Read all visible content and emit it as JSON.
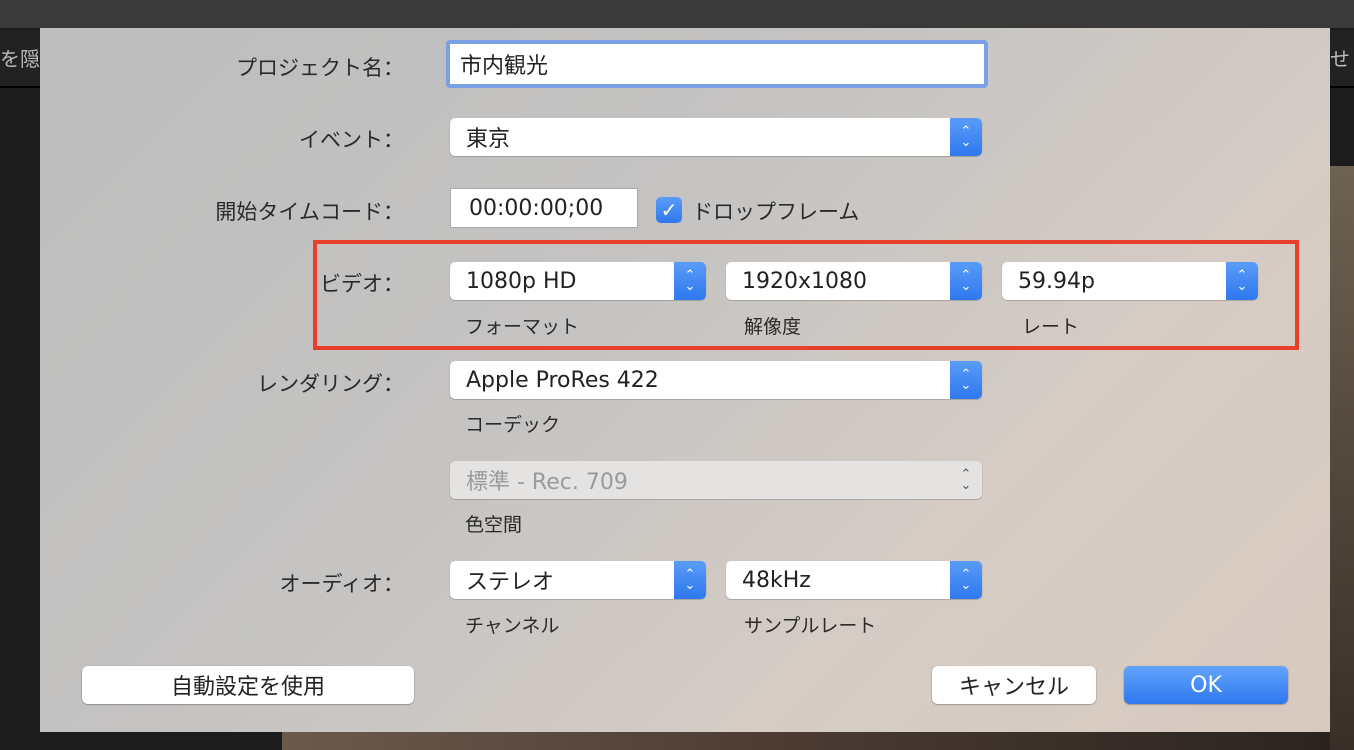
{
  "background": {
    "left_fragment": "を隠す",
    "right_fragment": "せ"
  },
  "project_name": {
    "label": "プロジェクト名：",
    "value": "市内観光"
  },
  "event": {
    "label": "イベント：",
    "value": "東京"
  },
  "timecode": {
    "label": "開始タイムコード：",
    "value": "00:00:00;00",
    "drop_frame_label": "ドロップフレーム",
    "drop_frame_checked": true
  },
  "video": {
    "label": "ビデオ：",
    "format": {
      "value": "1080p HD",
      "caption": "フォーマット"
    },
    "resolution": {
      "value": "1920x1080",
      "caption": "解像度"
    },
    "rate": {
      "value": "59.94p",
      "caption": "レート"
    }
  },
  "rendering": {
    "label": "レンダリング：",
    "codec": {
      "value": "Apple ProRes 422",
      "caption": "コーデック"
    },
    "color_space": {
      "value": "標準 - Rec. 709",
      "caption": "色空間"
    }
  },
  "audio": {
    "label": "オーディオ：",
    "channels": {
      "value": "ステレオ",
      "caption": "チャンネル"
    },
    "sample_rate": {
      "value": "48kHz",
      "caption": "サンプルレート"
    }
  },
  "buttons": {
    "auto": "自動設定を使用",
    "cancel": "キャンセル",
    "ok": "OK"
  },
  "colors": {
    "accent": "#2f78ef",
    "highlight": "#e83f2a"
  }
}
